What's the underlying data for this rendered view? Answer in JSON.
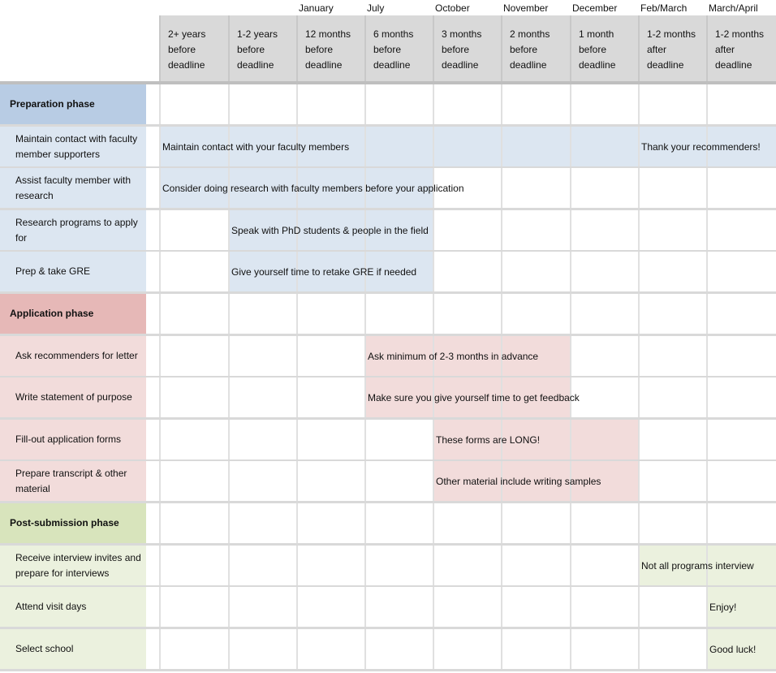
{
  "months": [
    "",
    "",
    "January",
    "July",
    "October",
    "November",
    "December",
    "Feb/March",
    "March/April"
  ],
  "columns": [
    "2+ years\nbefore\ndeadline",
    "1-2 years\nbefore\ndeadline",
    "12 months\nbefore\ndeadline",
    "6 months\nbefore\ndeadline",
    "3 months\n before\ndeadline",
    "2 months\n before\ndeadline",
    "1 month\nbefore\ndeadline",
    "1-2 months\nafter\ndeadline",
    "1-2 months\nafter\ndeadline"
  ],
  "colors": {
    "prep_phase": "#b8cce4",
    "prep_row": "#dce6f1",
    "app_phase": "#e6b8b7",
    "app_row": "#f2dcdb",
    "post_phase": "#d8e4bc",
    "post_row": "#ebf1de",
    "header_bg": "#d9d9d9"
  },
  "rows": [
    {
      "type": "phase",
      "group": "prep",
      "label": "Preparation phase",
      "spans": []
    },
    {
      "type": "task",
      "group": "prep",
      "label": "Maintain contact with faculty member supporters",
      "spans": [
        {
          "from": 0,
          "to": 6,
          "note": "Maintain contact with your faculty members"
        },
        {
          "from": 7,
          "to": 8,
          "note": "Thank your recommenders!"
        }
      ]
    },
    {
      "type": "task",
      "group": "prep",
      "label": "Assist faculty member with research",
      "spans": [
        {
          "from": 0,
          "to": 3,
          "note": "Consider doing research with faculty members before your application"
        }
      ]
    },
    {
      "type": "task",
      "group": "prep",
      "label": "Research programs to apply for",
      "spans": [
        {
          "from": 1,
          "to": 3,
          "note": "Speak with PhD students & people in the field"
        }
      ]
    },
    {
      "type": "task",
      "group": "prep",
      "label": "Prep & take GRE",
      "spans": [
        {
          "from": 1,
          "to": 3,
          "note": "Give yourself time to retake GRE if needed"
        }
      ]
    },
    {
      "type": "phase",
      "group": "app",
      "label": "Application phase",
      "spans": []
    },
    {
      "type": "task",
      "group": "app",
      "label": "Ask recommenders for letter",
      "spans": [
        {
          "from": 3,
          "to": 5,
          "note": "Ask minimum of 2-3 months in advance"
        }
      ]
    },
    {
      "type": "task",
      "group": "app",
      "label": "Write statement of purpose",
      "spans": [
        {
          "from": 3,
          "to": 5,
          "note": "Make sure you give yourself time to get feedback"
        }
      ]
    },
    {
      "type": "task",
      "group": "app",
      "label": "Fill-out application forms",
      "spans": [
        {
          "from": 4,
          "to": 6,
          "note": "These forms are LONG!"
        }
      ]
    },
    {
      "type": "task",
      "group": "app",
      "label": "Prepare transcript & other material",
      "spans": [
        {
          "from": 4,
          "to": 6,
          "note": "Other material include writing samples"
        }
      ]
    },
    {
      "type": "phase",
      "group": "post",
      "label": "Post-submission phase",
      "spans": []
    },
    {
      "type": "task",
      "group": "post",
      "label": "Receive interview invites and prepare for interviews",
      "spans": [
        {
          "from": 7,
          "to": 8,
          "note": "Not all programs interview"
        }
      ]
    },
    {
      "type": "task",
      "group": "post",
      "label": "Attend visit days",
      "spans": [
        {
          "from": 8,
          "to": 8,
          "note": "Enjoy!"
        }
      ]
    },
    {
      "type": "task",
      "group": "post",
      "label": "Select school",
      "spans": [
        {
          "from": 8,
          "to": 8,
          "note": "Good luck!"
        }
      ]
    }
  ]
}
